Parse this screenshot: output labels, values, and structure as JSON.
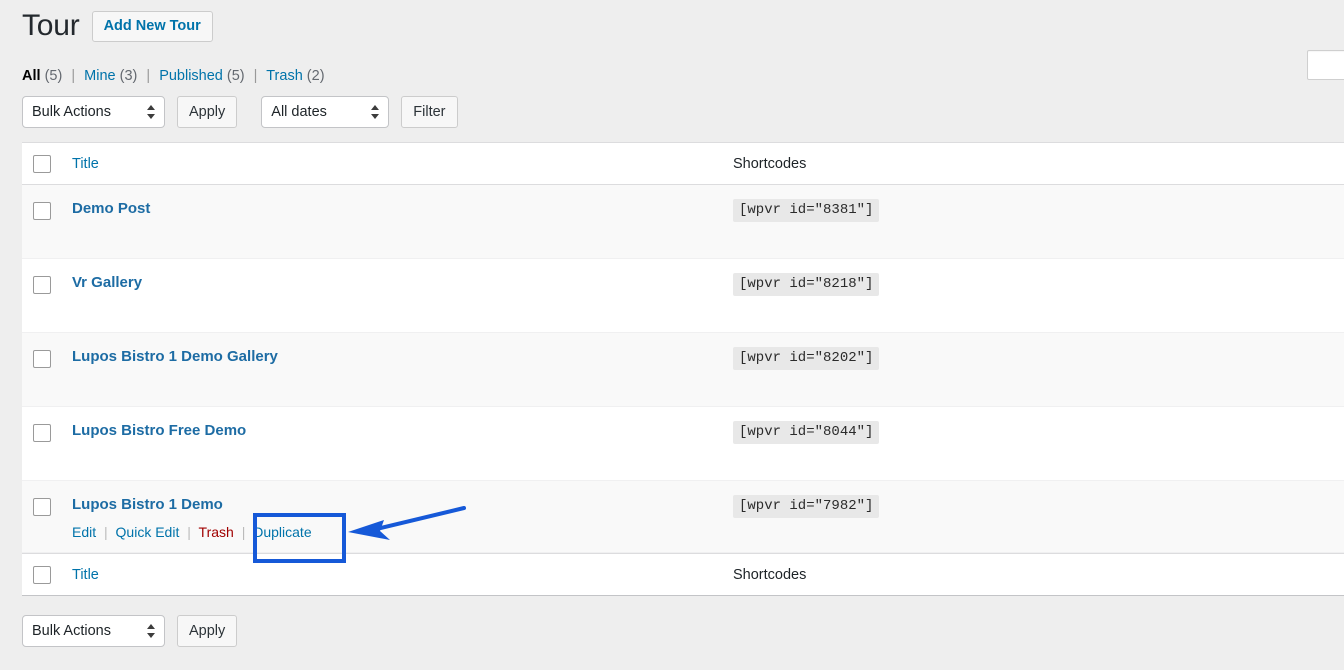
{
  "header": {
    "title": "Tour",
    "add_new_label": "Add New Tour"
  },
  "search": {
    "value": "",
    "placeholder": ""
  },
  "status_links": [
    {
      "label": "All",
      "count": "(5)",
      "current": true
    },
    {
      "label": "Mine",
      "count": "(3)",
      "current": false
    },
    {
      "label": "Published",
      "count": "(5)",
      "current": false
    },
    {
      "label": "Trash",
      "count": "(2)",
      "current": false
    }
  ],
  "tablenav": {
    "bulk_actions_label": "Bulk Actions",
    "apply_label": "Apply",
    "dates_label": "All dates",
    "filter_label": "Filter"
  },
  "table": {
    "columns": {
      "title": "Title",
      "shortcodes": "Shortcodes"
    },
    "rows": [
      {
        "title": "Demo Post",
        "shortcode": "[wpvr id=\"8381\"]"
      },
      {
        "title": "Vr Gallery",
        "shortcode": "[wpvr id=\"8218\"]"
      },
      {
        "title": "Lupos Bistro 1 Demo Gallery",
        "shortcode": "[wpvr id=\"8202\"]"
      },
      {
        "title": "Lupos Bistro Free Demo",
        "shortcode": "[wpvr id=\"8044\"]"
      },
      {
        "title": "Lupos Bistro 1 Demo",
        "shortcode": "[wpvr id=\"7982\"]",
        "actions": {
          "edit": "Edit",
          "quick_edit": "Quick Edit",
          "trash": "Trash",
          "duplicate": "Duplicate"
        }
      }
    ]
  },
  "annotation": {
    "highlight_color": "#1659d8",
    "arrow_color": "#1659d8",
    "target": "Duplicate"
  },
  "colors": {
    "page_background": "#eeeeee",
    "link_blue": "#0073aa",
    "title_blue": "#1d6ca4",
    "trash_red": "#a00000",
    "row_alt": "#f9f9f9"
  }
}
